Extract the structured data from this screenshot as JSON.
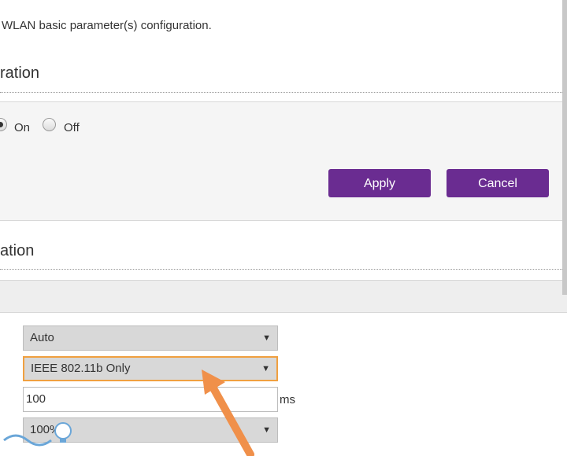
{
  "page": {
    "description": "WLAN basic parameter(s) configuration."
  },
  "section1": {
    "title": "ration",
    "radio_on_label": "On",
    "radio_off_label": "Off",
    "apply_label": "Apply",
    "cancel_label": "Cancel"
  },
  "section2": {
    "title": "ation",
    "select1_value": "Auto",
    "select2_value": "IEEE 802.11b Only",
    "input_value": "100",
    "input_unit": "ms",
    "select4_value": "100%"
  },
  "colors": {
    "accent": "#6a2c91",
    "highlight": "#f0a040",
    "annotation_arrow": "#f0904a"
  },
  "icons": {
    "dropdown": "triangle-down",
    "annotation": "orange-arrow",
    "watermark": "bulb-logo"
  }
}
